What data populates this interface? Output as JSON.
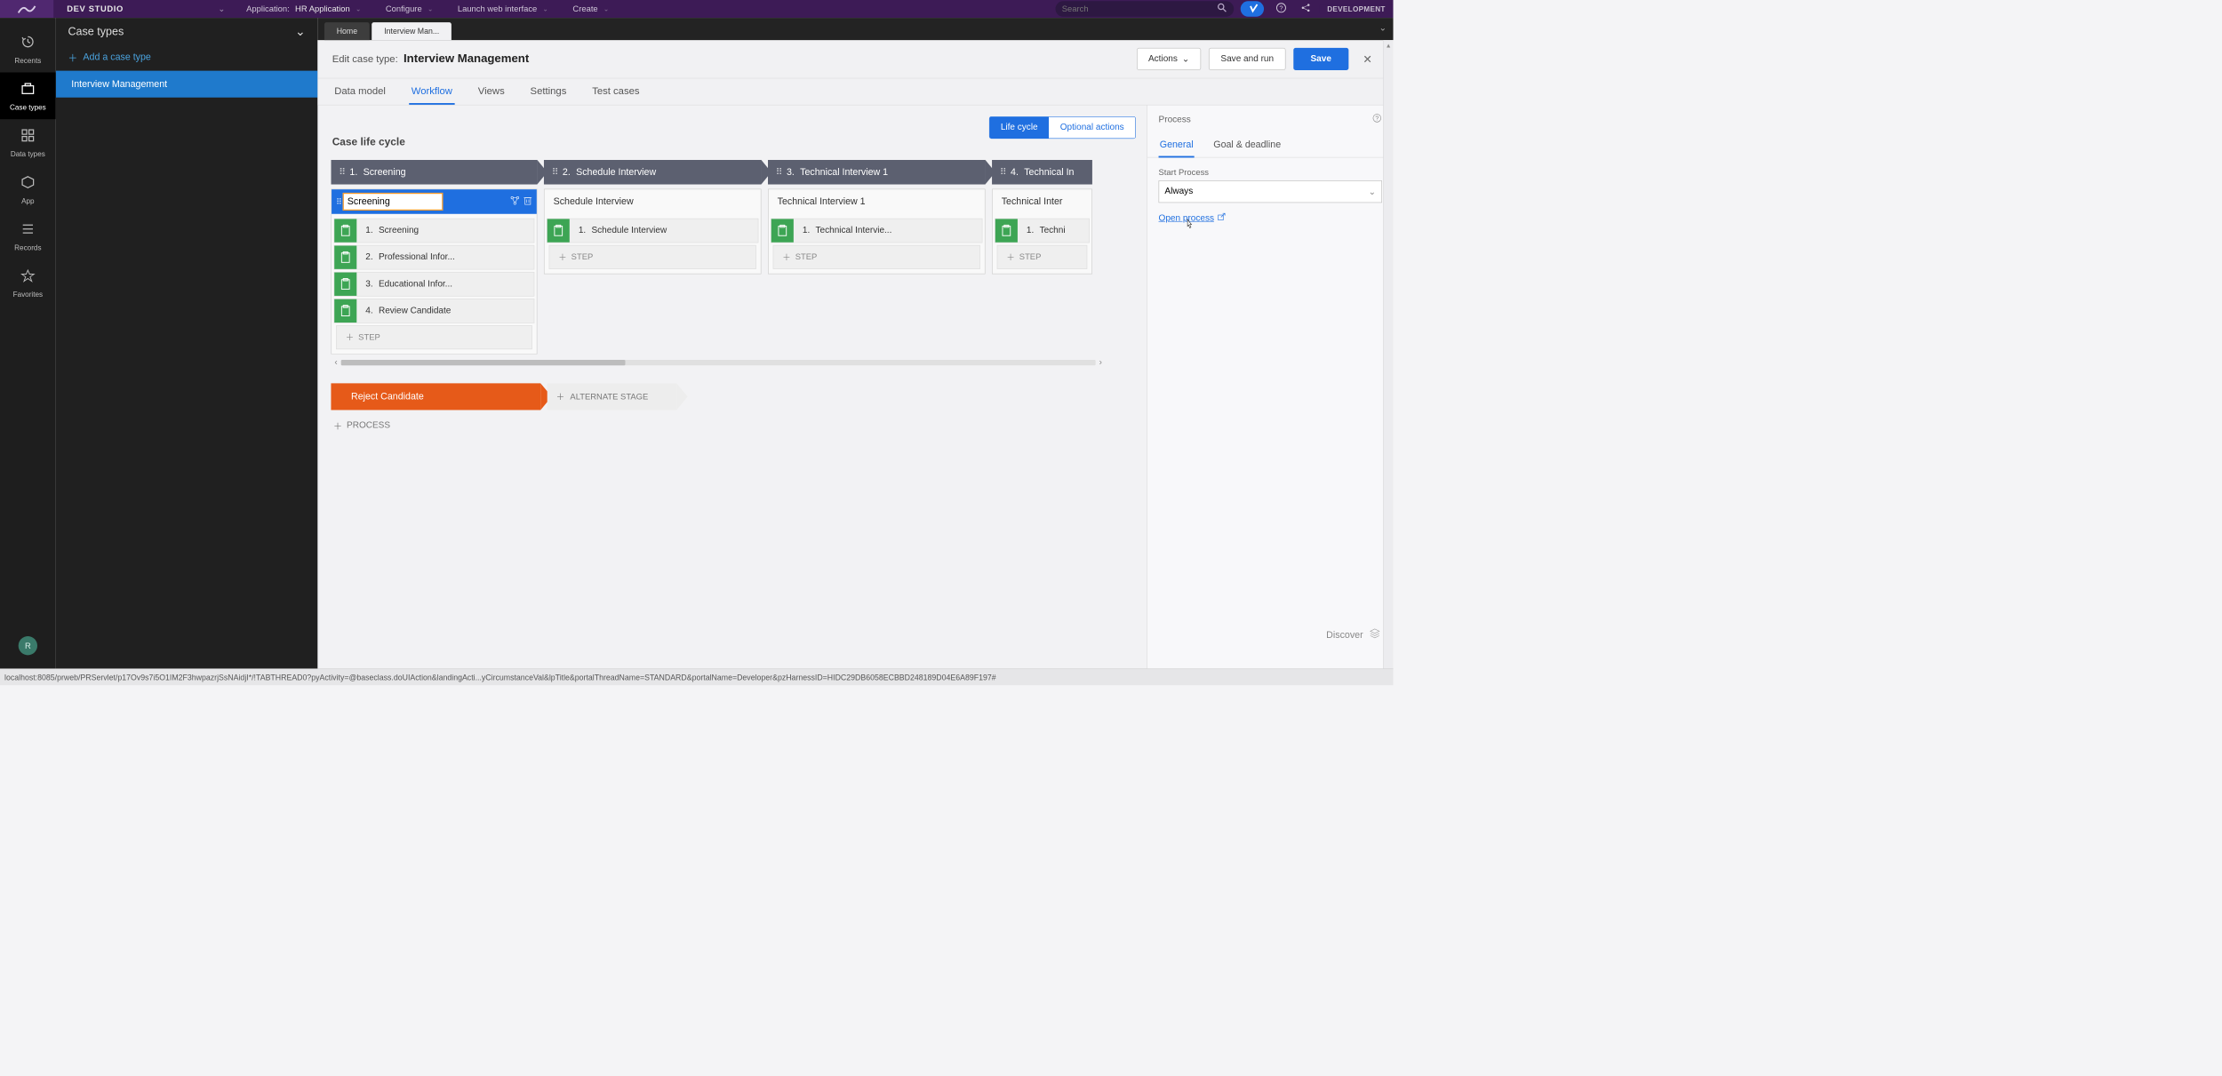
{
  "topbar": {
    "logo": "DEV STUDIO",
    "app_label": "Application:",
    "app_name": "HR Application",
    "menu": [
      "Configure",
      "Launch web interface",
      "Create"
    ],
    "search_placeholder": "Search",
    "env": "DEVELOPMENT"
  },
  "rail": {
    "items": [
      "Recents",
      "Case types",
      "Data types",
      "App",
      "Records",
      "Favorites"
    ],
    "avatar": "R"
  },
  "leftpanel": {
    "title": "Case types",
    "add": "Add a case type",
    "items": [
      "Interview Management"
    ]
  },
  "tabs": {
    "home": "Home",
    "active": "Interview Man..."
  },
  "header": {
    "label": "Edit case type:",
    "title": "Interview Management",
    "actions_btn": "Actions",
    "save_run": "Save and run",
    "save": "Save"
  },
  "subtabs": [
    "Data model",
    "Workflow",
    "Views",
    "Settings",
    "Test cases"
  ],
  "view_toggle": {
    "a": "Life cycle",
    "b": "Optional actions"
  },
  "section_title": "Case life cycle",
  "stages": [
    {
      "num": "1.",
      "name": "Screening",
      "proc": {
        "name": "Screening",
        "selected": true
      },
      "steps": [
        {
          "n": "1.",
          "l": "Screening"
        },
        {
          "n": "2.",
          "l": "Professional Infor..."
        },
        {
          "n": "3.",
          "l": "Educational Infor..."
        },
        {
          "n": "4.",
          "l": "Review Candidate"
        }
      ]
    },
    {
      "num": "2.",
      "name": "Schedule Interview",
      "proc": {
        "name": "Schedule Interview"
      },
      "steps": [
        {
          "n": "1.",
          "l": "Schedule Interview"
        }
      ]
    },
    {
      "num": "3.",
      "name": "Technical Interview 1",
      "proc": {
        "name": "Technical Interview 1"
      },
      "steps": [
        {
          "n": "1.",
          "l": "Technical Intervie..."
        }
      ]
    },
    {
      "num": "4.",
      "name_cut": "Technical In",
      "proc": {
        "name_cut": "Technical Inter"
      },
      "steps": [
        {
          "n": "1.",
          "l": "Techni"
        }
      ]
    }
  ],
  "add_step": "STEP",
  "reject": "Reject Candidate",
  "alt_stage": "ALTERNATE STAGE",
  "add_process": "PROCESS",
  "inspector": {
    "title": "Process",
    "tabs": [
      "General",
      "Goal & deadline"
    ],
    "field": "Start Process",
    "value": "Always",
    "link": "Open process"
  },
  "discover": "Discover",
  "statusbar": "localhost:8085/prweb/PRServlet/p17Ov9s7i5O1IM2F3hwpazrjSsNAidjI*/!TABTHREAD0?pyActivity=@baseclass.doUIAction&landingActi...yCircumstanceVal&lpTitle&portalThreadName=STANDARD&portalName=Developer&pzHarnessID=HIDC29DB6058ECBBD248189D04E6A89F197#"
}
